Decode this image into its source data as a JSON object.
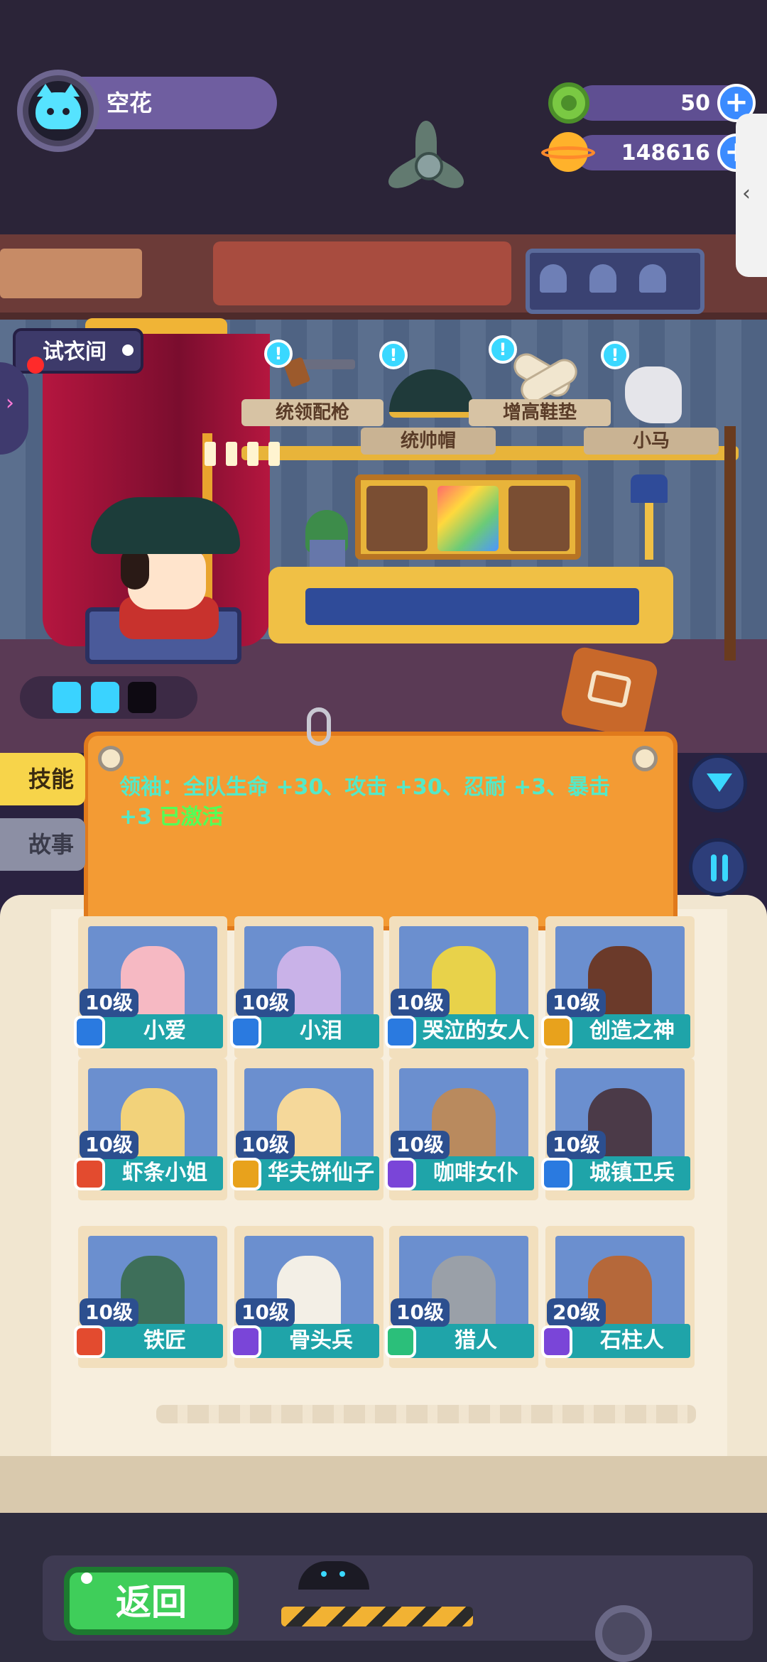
{
  "player": {
    "name": "空花"
  },
  "currencies": [
    {
      "icon": "green-gem-icon",
      "amount": "50"
    },
    {
      "icon": "gold-planet-coin-icon",
      "amount": "148616"
    }
  ],
  "room": {
    "fitting_room_label": "试衣间",
    "items": [
      {
        "label": "统领配枪",
        "icon": "pistol-icon"
      },
      {
        "label": "统帅帽",
        "icon": "bicorne-hat-icon"
      },
      {
        "label": "增高鞋垫",
        "icon": "insole-icon"
      },
      {
        "label": "小马",
        "icon": "pony-icon"
      }
    ],
    "hint_glyph": "!",
    "battery": {
      "filled": 2,
      "total": 3
    }
  },
  "tabs": {
    "skill": "技能",
    "story": "故事"
  },
  "skill_panel": {
    "text": "领袖：全队生命 +30、攻击 +30、忍耐 +3、暴击 +3",
    "status": "已激活"
  },
  "characters": [
    {
      "name": "小爱",
      "level": "10级",
      "badge": "blue",
      "color": "#f6b9c3"
    },
    {
      "name": "小泪",
      "level": "10级",
      "badge": "blue",
      "color": "#c9b2e8"
    },
    {
      "name": "哭泣的女人",
      "level": "10级",
      "badge": "blue",
      "color": "#e8d24a"
    },
    {
      "name": "创造之神",
      "level": "10级",
      "badge": "gold",
      "color": "#6b3a2a"
    },
    {
      "name": "虾条小姐",
      "level": "10级",
      "badge": "red",
      "color": "#f2d27a"
    },
    {
      "name": "华夫饼仙子",
      "level": "10级",
      "badge": "gold",
      "color": "#f5d89a"
    },
    {
      "name": "咖啡女仆",
      "level": "10级",
      "badge": "purple",
      "color": "#b98a5e"
    },
    {
      "name": "城镇卫兵",
      "level": "10级",
      "badge": "blue",
      "color": "#4b3a48"
    },
    {
      "name": "铁匠",
      "level": "10级",
      "badge": "red",
      "color": "#3e6f5a"
    },
    {
      "name": "骨头兵",
      "level": "10级",
      "badge": "purple",
      "color": "#f3efe6"
    },
    {
      "name": "猎人",
      "level": "10级",
      "badge": "green",
      "color": "#9aa0a8"
    },
    {
      "name": "石柱人",
      "level": "20级",
      "badge": "purple",
      "color": "#b5683a"
    }
  ],
  "back_button": "返回",
  "colors": {
    "accent_teal": "#1fa4a9",
    "panel_orange": "#f39b34",
    "skill_text": "#53e9c8",
    "active_green": "#53ff56"
  }
}
